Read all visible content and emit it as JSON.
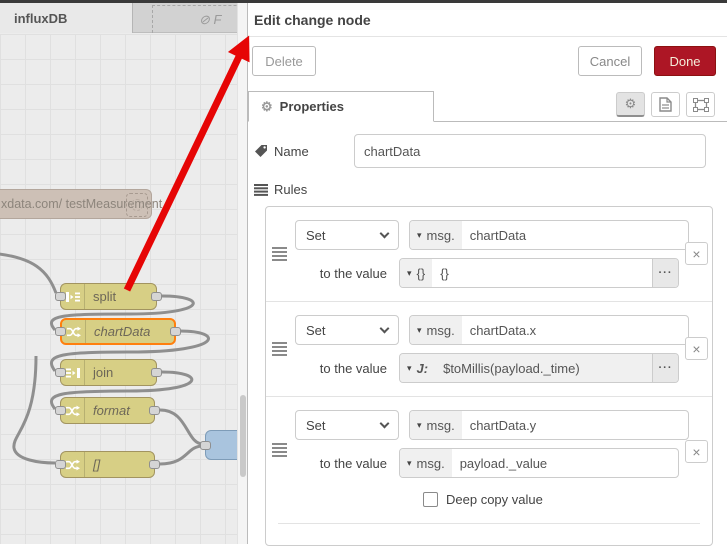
{
  "workspace": {
    "tabs": [
      {
        "label": "influxDB"
      },
      {
        "label": "⊘ F"
      }
    ],
    "nodes": {
      "influx": {
        "label": "xdata.com/ testMeasurement"
      },
      "split": {
        "label": "split"
      },
      "chartData": {
        "label": "chartData"
      },
      "join": {
        "label": "join"
      },
      "format": {
        "label": "format"
      },
      "array": {
        "label": "[]"
      }
    }
  },
  "panel": {
    "title": "Edit change node",
    "buttons": {
      "delete": "Delete",
      "cancel": "Cancel",
      "done": "Done"
    },
    "tabs": {
      "properties": "Properties"
    },
    "fields": {
      "name_label": "Name",
      "name_value": "chartData",
      "rules_label": "Rules",
      "to_the_value": "to the value",
      "deep_copy": "Deep copy value"
    },
    "rules": [
      {
        "action": "Set",
        "prop_type": "msg.",
        "prop": "chartData",
        "value_type": "{}",
        "value": "{}"
      },
      {
        "action": "Set",
        "prop_type": "msg.",
        "prop": "chartData.x",
        "value_type": "J:",
        "value": "$toMillis(payload._time)"
      },
      {
        "action": "Set",
        "prop_type": "msg.",
        "prop": "chartData.y",
        "value_type": "msg.",
        "value": "payload._value"
      }
    ],
    "expand_glyph": "···",
    "remove_glyph": "×",
    "gear_glyph": "⚙"
  },
  "colors": {
    "done_bg": "#AD1625",
    "selected_node_border": "#ff7f0e",
    "arrow": "#e60505",
    "node_fill": "#d7cf85"
  }
}
